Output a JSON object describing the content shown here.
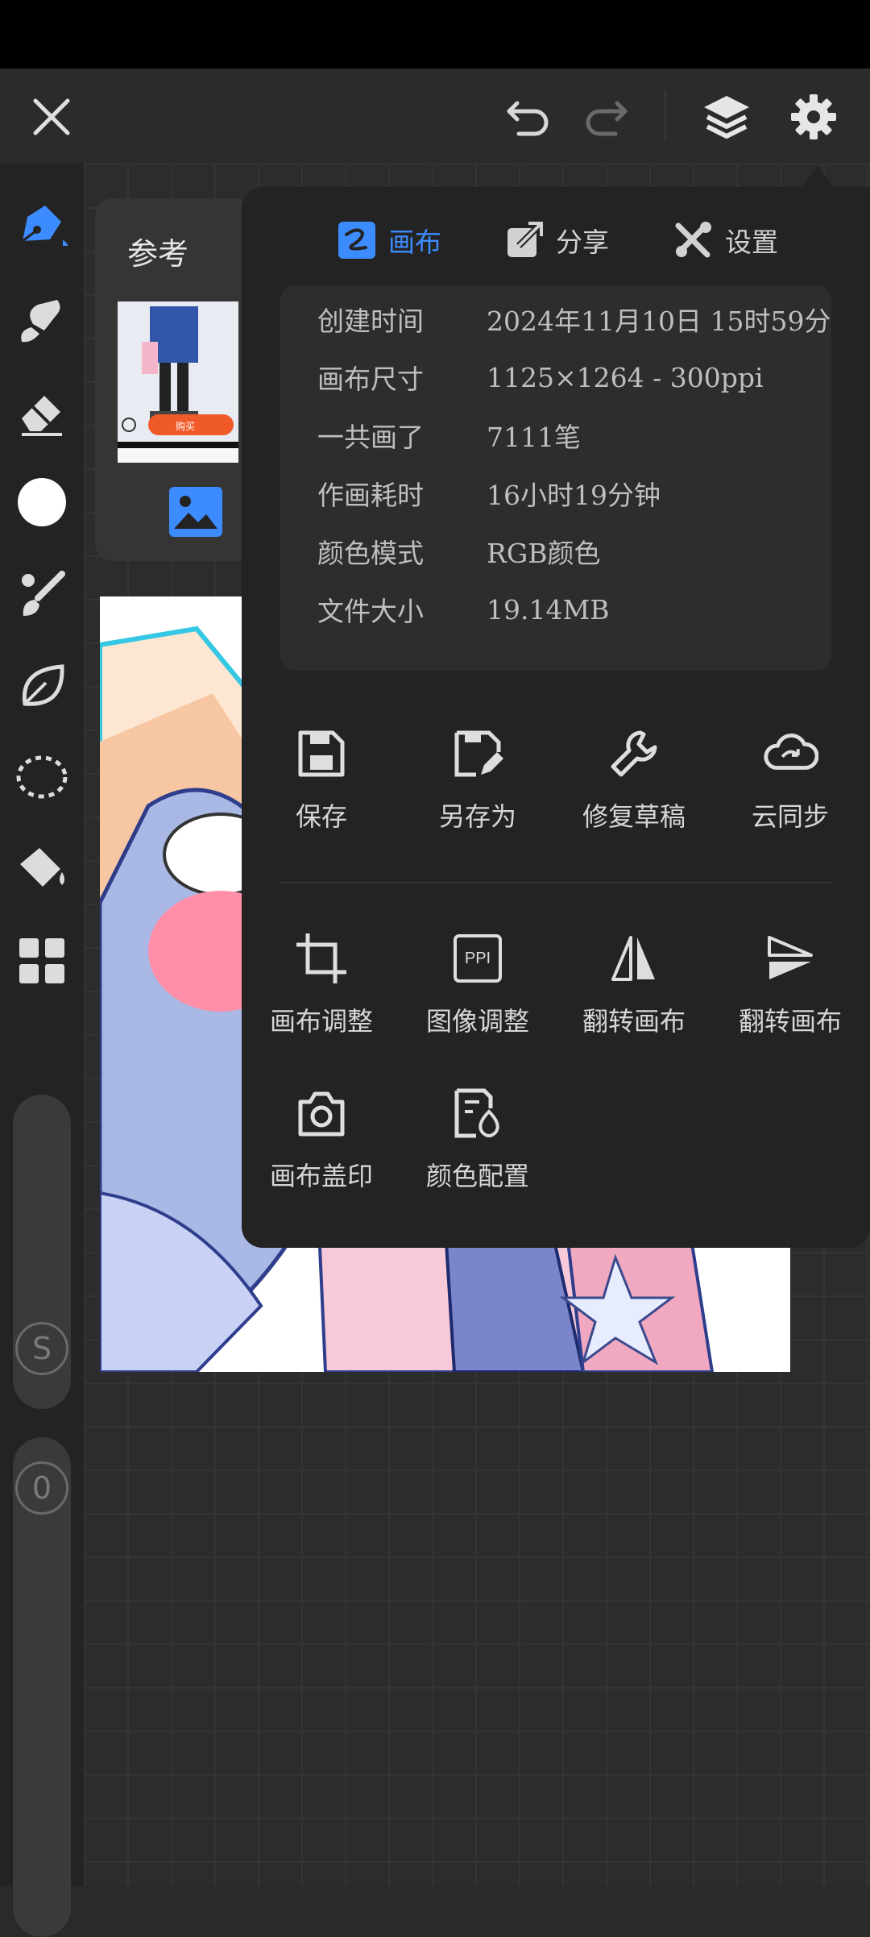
{
  "topbar": {
    "close": "close-icon",
    "undo": "undo-icon",
    "redo": "redo-icon",
    "layers": "layers-icon",
    "settings": "gear-icon"
  },
  "toolbar": {
    "tools": [
      "pencil-icon",
      "smudge-icon",
      "eraser-icon",
      "color-circle-icon",
      "brush-icon",
      "leaf-icon",
      "lasso-icon",
      "bucket-icon",
      "grid-icon"
    ],
    "size_label": "S",
    "opacity_label": "0"
  },
  "reference": {
    "title": "参考",
    "badge": "购买"
  },
  "menu": {
    "tabs": [
      {
        "label": "画布",
        "active": true
      },
      {
        "label": "分享",
        "active": false
      },
      {
        "label": "设置",
        "active": false
      }
    ],
    "info": [
      {
        "key": "创建时间",
        "value": "2024年11月10日 15时59分"
      },
      {
        "key": "画布尺寸",
        "value": "1125×1264 - 300ppi"
      },
      {
        "key": "一共画了",
        "value": "7111笔"
      },
      {
        "key": "作画耗时",
        "value": "16小时19分钟"
      },
      {
        "key": "颜色模式",
        "value": "RGB颜色"
      },
      {
        "key": "文件大小",
        "value": "19.14MB"
      }
    ],
    "actions_row1": [
      {
        "label": "保存",
        "icon": "save-icon"
      },
      {
        "label": "另存为",
        "icon": "save-as-icon"
      },
      {
        "label": "修复草稿",
        "icon": "wrench-icon"
      },
      {
        "label": "云同步",
        "icon": "cloud-sync-icon"
      }
    ],
    "actions_row2": [
      {
        "label": "画布调整",
        "icon": "crop-icon"
      },
      {
        "label": "图像调整",
        "icon": "ppi-icon",
        "icon_text": "PPI"
      },
      {
        "label": "翻转画布",
        "icon": "flip-horizontal-icon"
      },
      {
        "label": "翻转画布",
        "icon": "flip-vertical-icon"
      }
    ],
    "actions_row3": [
      {
        "label": "画布盖印",
        "icon": "camera-icon"
      },
      {
        "label": "颜色配置",
        "icon": "color-profile-icon"
      }
    ]
  },
  "colors": {
    "accent": "#3d8cff",
    "panel": "#232323",
    "info_bg": "#2d2d2d"
  }
}
